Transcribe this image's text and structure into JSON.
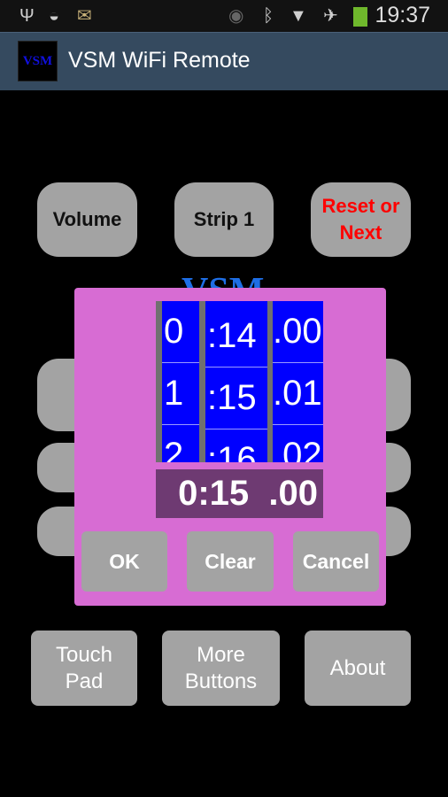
{
  "status_bar": {
    "time": "19:37",
    "icons": [
      "usb-icon",
      "wifi-lock-icon",
      "email-icon",
      "eye-icon",
      "bluetooth-icon",
      "wifi-signal-icon",
      "airplane-icon",
      "battery-charging-icon"
    ]
  },
  "action_bar": {
    "logo": "VSM",
    "title": "VSM WiFi Remote"
  },
  "top_buttons": {
    "volume": "Volume",
    "strip": "Strip 1",
    "reset": "Reset or Next",
    "reset_color": "#ff0000"
  },
  "background_logo": "VSM",
  "dialog": {
    "columns": [
      {
        "values": [
          "0",
          "1",
          "2"
        ]
      },
      {
        "values": [
          ":14",
          ":15",
          ":16"
        ]
      },
      {
        "values": [
          ".00",
          ".01",
          ".02"
        ]
      }
    ],
    "display": "0:15  .00",
    "ok": "OK",
    "clear": "Clear",
    "cancel": "Cancel"
  },
  "bottom_buttons": {
    "touch_pad": "Touch Pad",
    "more_buttons": "More Buttons",
    "about": "About"
  }
}
